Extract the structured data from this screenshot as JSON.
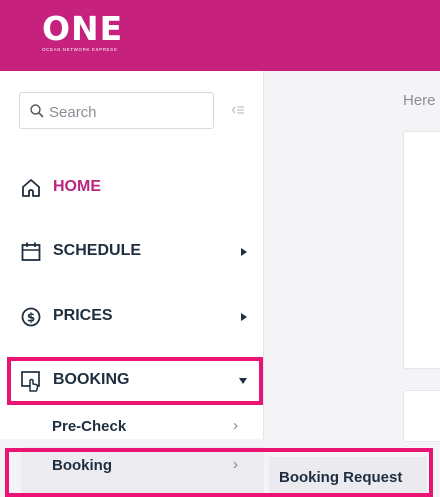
{
  "header": {
    "logo_text": "ONE",
    "logo_tagline": "OCEAN NETWORK EXPRESS"
  },
  "sidebar": {
    "search_placeholder": "Search",
    "items": [
      {
        "label": "HOME",
        "icon": "home-icon"
      },
      {
        "label": "SCHEDULE",
        "icon": "calendar-icon"
      },
      {
        "label": "PRICES",
        "icon": "dollar-circle-icon"
      },
      {
        "label": "BOOKING",
        "icon": "booking-hand-icon"
      }
    ],
    "booking_subitems": [
      {
        "label": "Pre-Check"
      },
      {
        "label": "Booking"
      }
    ]
  },
  "flyout": {
    "items": [
      {
        "label": "Booking Request"
      }
    ]
  },
  "main": {
    "partial_text": "Here"
  },
  "colors": {
    "brand": "#c6217d",
    "highlight": "#ea1474"
  }
}
